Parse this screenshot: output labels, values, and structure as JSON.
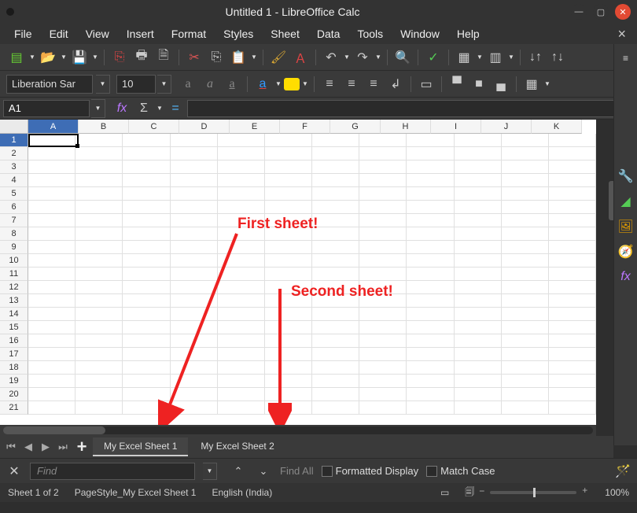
{
  "window": {
    "title": "Untitled 1 - LibreOffice Calc"
  },
  "menu": {
    "items": [
      "File",
      "Edit",
      "View",
      "Insert",
      "Format",
      "Styles",
      "Sheet",
      "Data",
      "Tools",
      "Window",
      "Help"
    ]
  },
  "font": {
    "name": "Liberation Sar",
    "size": "10"
  },
  "namebox": {
    "ref": "A1"
  },
  "columns": [
    "A",
    "B",
    "C",
    "D",
    "E",
    "F",
    "G",
    "H",
    "I",
    "J",
    "K"
  ],
  "rows": [
    "1",
    "2",
    "3",
    "4",
    "5",
    "6",
    "7",
    "8",
    "9",
    "10",
    "11",
    "12",
    "13",
    "14",
    "15",
    "16",
    "17",
    "18",
    "19",
    "20",
    "21"
  ],
  "annotations": {
    "first": "First sheet!",
    "second": "Second sheet!"
  },
  "tabs": {
    "sheet1": "My Excel Sheet 1",
    "sheet2": "My Excel Sheet 2"
  },
  "find": {
    "placeholder": "Find",
    "findall": "Find All",
    "formatted": "Formatted Display",
    "matchcase": "Match Case"
  },
  "status": {
    "sheet": "Sheet 1 of 2",
    "pagestyle": "PageStyle_My Excel Sheet 1",
    "lang": "English (India)",
    "zoom": "100%"
  }
}
